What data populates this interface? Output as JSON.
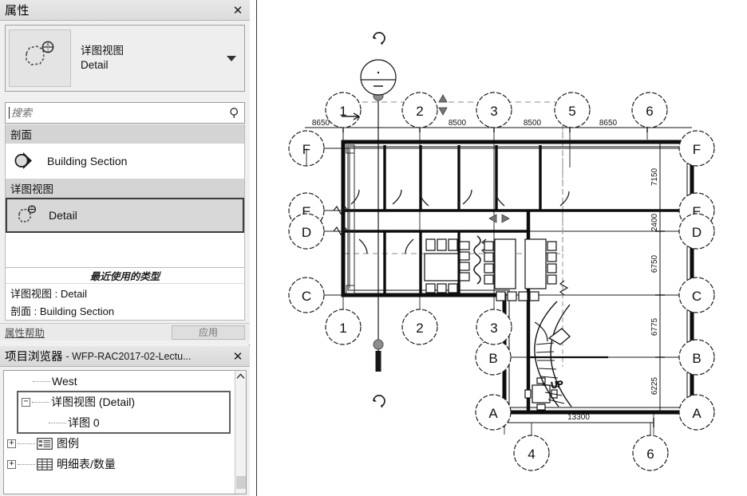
{
  "properties_panel": {
    "title": "属性",
    "close_label": "✕",
    "type_selector": {
      "family": "详图视图",
      "type": "Detail",
      "thumb_icon": "detail-view-tag-icon",
      "dropdown_icon": "chevron-down-icon"
    },
    "search": {
      "placeholder": "搜索",
      "value": "",
      "icon": "search-icon"
    },
    "groups": [
      {
        "header": "剖面",
        "items": [
          {
            "label": "Building Section",
            "icon": "section-head-icon",
            "selected": false
          }
        ]
      },
      {
        "header": "详图视图",
        "items": [
          {
            "label": "Detail",
            "icon": "detail-view-tag-icon",
            "selected": true
          }
        ]
      }
    ],
    "recent": {
      "header": "最近使用的类型",
      "items": [
        "详图视图 : Detail",
        "剖面 : Building Section"
      ]
    },
    "actions": {
      "help_label": "属性帮助",
      "apply_label": "应用"
    }
  },
  "project_browser": {
    "title": "项目浏览器",
    "subtitle": "- WFP-RAC2017-02-Lectu...",
    "close_label": "✕",
    "scroll_up_icon": "chevron-up-icon",
    "nodes": [
      {
        "label": "West",
        "indent": 3,
        "toggle": "",
        "icon": "",
        "highlighted": false
      },
      {
        "label": "详图视图 (Detail)",
        "indent": 2,
        "toggle": "−",
        "icon": "",
        "highlighted": true
      },
      {
        "label": "详图 0",
        "indent": 3,
        "toggle": "",
        "icon": "",
        "highlighted": true
      },
      {
        "label": "图例",
        "indent": 1,
        "toggle": "+",
        "icon": "legend-icon",
        "highlighted": false
      },
      {
        "label": "明细表/数量",
        "indent": 1,
        "toggle": "+",
        "icon": "schedule-table-icon",
        "highlighted": false
      }
    ]
  },
  "drawing": {
    "top_grid_bubbles": [
      "1",
      "2",
      "3",
      "5",
      "6"
    ],
    "bottom_grid_bubbles": [
      "1",
      "2",
      "3",
      "4",
      "6"
    ],
    "left_grid_bubbles": [
      "F",
      "E",
      "D",
      "C"
    ],
    "right_grid_bubbles": [
      "F",
      "E",
      "D",
      "C",
      "B",
      "A"
    ],
    "inner_grid_bubbles": [
      "B",
      "A"
    ],
    "horizontal_dimensions": [
      "8650",
      "8500",
      "8500",
      "8650"
    ],
    "vertical_dimensions": [
      "7150",
      "2400",
      "6750",
      "6775",
      "6225"
    ],
    "bottom_dimension": "13300",
    "stair_label": "UP",
    "section_head_icon": "section-head-marker",
    "rotate_icons": [
      "rotate-handle-icon",
      "rotate-handle-icon"
    ],
    "flip_arrows_icon": "flip-control-arrows"
  }
}
